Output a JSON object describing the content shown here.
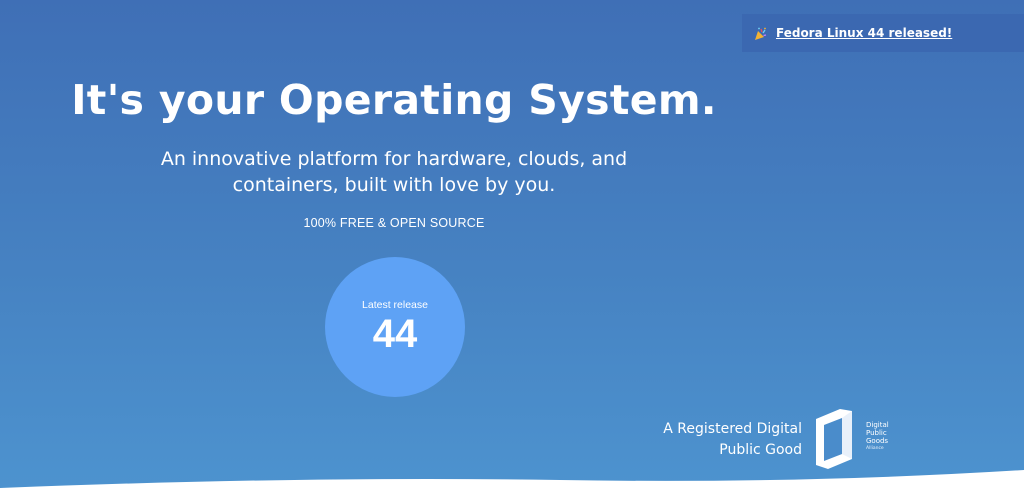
{
  "announcement": {
    "text": "Fedora Linux 44 released!",
    "icon": "party-popper-icon"
  },
  "hero": {
    "title": "It's your Operating System.",
    "subtitle_line1": "An innovative platform for hardware, clouds, and",
    "subtitle_line2": "containers, built with love by you.",
    "free_label": "100% FREE & OPEN SOURCE"
  },
  "release": {
    "label": "Latest release",
    "version": "44"
  },
  "dpg": {
    "line1": "A Registered Digital",
    "line2": "Public Good",
    "logo_line1": "Digital",
    "logo_line2": "Public",
    "logo_line3": "Goods",
    "logo_line4": "Alliance"
  },
  "colors": {
    "background_top": "#3f6fb6",
    "background_bottom": "#4d93cf",
    "release_circle": "#5ea2f5",
    "announcement_bg": "#3b68b1"
  }
}
